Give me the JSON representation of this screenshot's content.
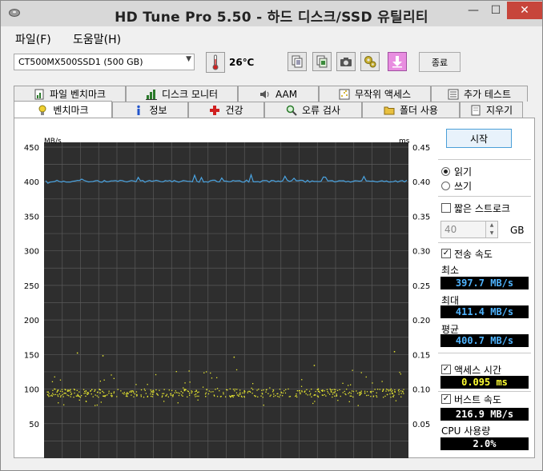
{
  "window": {
    "title": "HD Tune Pro 5.50 - 하드 디스크/SSD 유틸리티"
  },
  "titlebar_buttons": {
    "minimize": "—",
    "maximize": "☐",
    "close": "✕"
  },
  "menu": [
    "파일(F)",
    "도움말(H)"
  ],
  "toolbar": {
    "drive": "CT500MX500SSD1 (500 GB)",
    "temperature": "26℃",
    "exit_label": "종료",
    "icons": [
      "copy-text-icon",
      "copy-screenshot-icon",
      "camera-icon",
      "options-icon",
      "save-down-arrow-icon"
    ]
  },
  "tabs_top": [
    {
      "label": "파일 벤치마크",
      "icon": "file-benchmark-icon"
    },
    {
      "label": "디스크 모니터",
      "icon": "disk-monitor-icon"
    },
    {
      "label": "AAM",
      "icon": "speaker-icon"
    },
    {
      "label": "무작위 액세스",
      "icon": "random-access-icon"
    },
    {
      "label": "추가 테스트",
      "icon": "extra-tests-icon"
    }
  ],
  "tabs_bottom": [
    {
      "label": "벤치마크",
      "icon": "bulb-icon",
      "active": true
    },
    {
      "label": "정보",
      "icon": "info-icon"
    },
    {
      "label": "건강",
      "icon": "health-cross-icon"
    },
    {
      "label": "오류 검사",
      "icon": "magnifier-icon"
    },
    {
      "label": "폴더 사용",
      "icon": "folder-icon"
    },
    {
      "label": "지우기",
      "icon": "erase-icon"
    }
  ],
  "side": {
    "start_label": "시작",
    "read_label": "읽기",
    "write_label": "쓰기",
    "mode_selected": "read",
    "short_stroke_label": "짧은 스트로크",
    "short_stroke_checked": false,
    "short_stroke_value": "40",
    "short_stroke_unit": "GB",
    "transfer_rate_label": "전송 속도",
    "transfer_rate_checked": true,
    "min_label": "최소",
    "min_value": "397.7 MB/s",
    "max_label": "최대",
    "max_value": "411.4 MB/s",
    "avg_label": "평균",
    "avg_value": "400.7 MB/s",
    "access_time_label": "액세스 시간",
    "access_time_checked": true,
    "access_time_value": "0.095 ms",
    "burst_rate_label": "버스트 속도",
    "burst_rate_checked": true,
    "burst_rate_value": "216.9 MB/s",
    "cpu_label": "CPU 사용량",
    "cpu_value": "2.0%"
  },
  "chart_data": {
    "type": "line",
    "left_unit": "MB/s",
    "right_unit": "ms",
    "left_ticks": [
      "450",
      "400",
      "350",
      "300",
      "250",
      "200",
      "150",
      "100",
      "50"
    ],
    "right_ticks": [
      "0.45",
      "0.40",
      "0.35",
      "0.30",
      "0.25",
      "0.20",
      "0.15",
      "0.10",
      "0.05"
    ],
    "ylim_left": [
      0,
      450
    ],
    "ylim_right": [
      0,
      0.45
    ],
    "grid": true,
    "series": [
      {
        "name": "전송 속도",
        "axis": "left",
        "color": "#4aa3e0",
        "approx_value": 400.7,
        "min": 397.7,
        "max": 411.4
      },
      {
        "name": "액세스 시간",
        "axis": "right",
        "color": "#e8e830",
        "style": "scatter",
        "approx_value": 0.095,
        "min": 0.075,
        "max": 0.155
      }
    ]
  }
}
